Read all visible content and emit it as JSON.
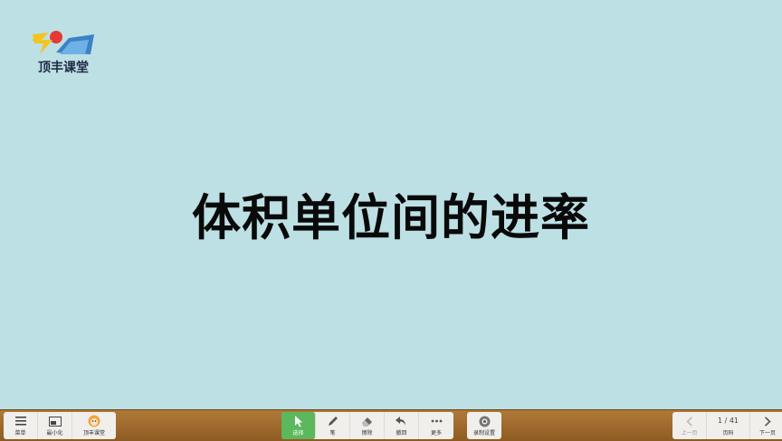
{
  "logo": {
    "text": "顶丰课堂"
  },
  "slide": {
    "title": "体积单位间的进率"
  },
  "toolbar": {
    "left": [
      {
        "label": "菜单",
        "icon": "menu-icon"
      },
      {
        "label": "最小化",
        "icon": "minimize-icon"
      },
      {
        "label": "顶丰课堂",
        "icon": "mascot-icon"
      }
    ],
    "center": [
      {
        "label": "选择",
        "icon": "cursor-icon",
        "active": true
      },
      {
        "label": "笔",
        "icon": "pen-icon"
      },
      {
        "label": "擦除",
        "icon": "eraser-icon"
      },
      {
        "label": "撤回",
        "icon": "undo-icon"
      },
      {
        "label": "更多",
        "icon": "more-icon"
      }
    ],
    "settings": {
      "label": "录制设置",
      "icon": "camera-icon"
    },
    "pager": {
      "prev_label": "上一页",
      "page_label": "页码",
      "next_label": "下一页",
      "page_indicator": "1 / 41"
    }
  },
  "colors": {
    "slide_bg": "#bde0e4",
    "toolbar_wood": "#a06b2e",
    "active_green": "#5cb85c"
  }
}
